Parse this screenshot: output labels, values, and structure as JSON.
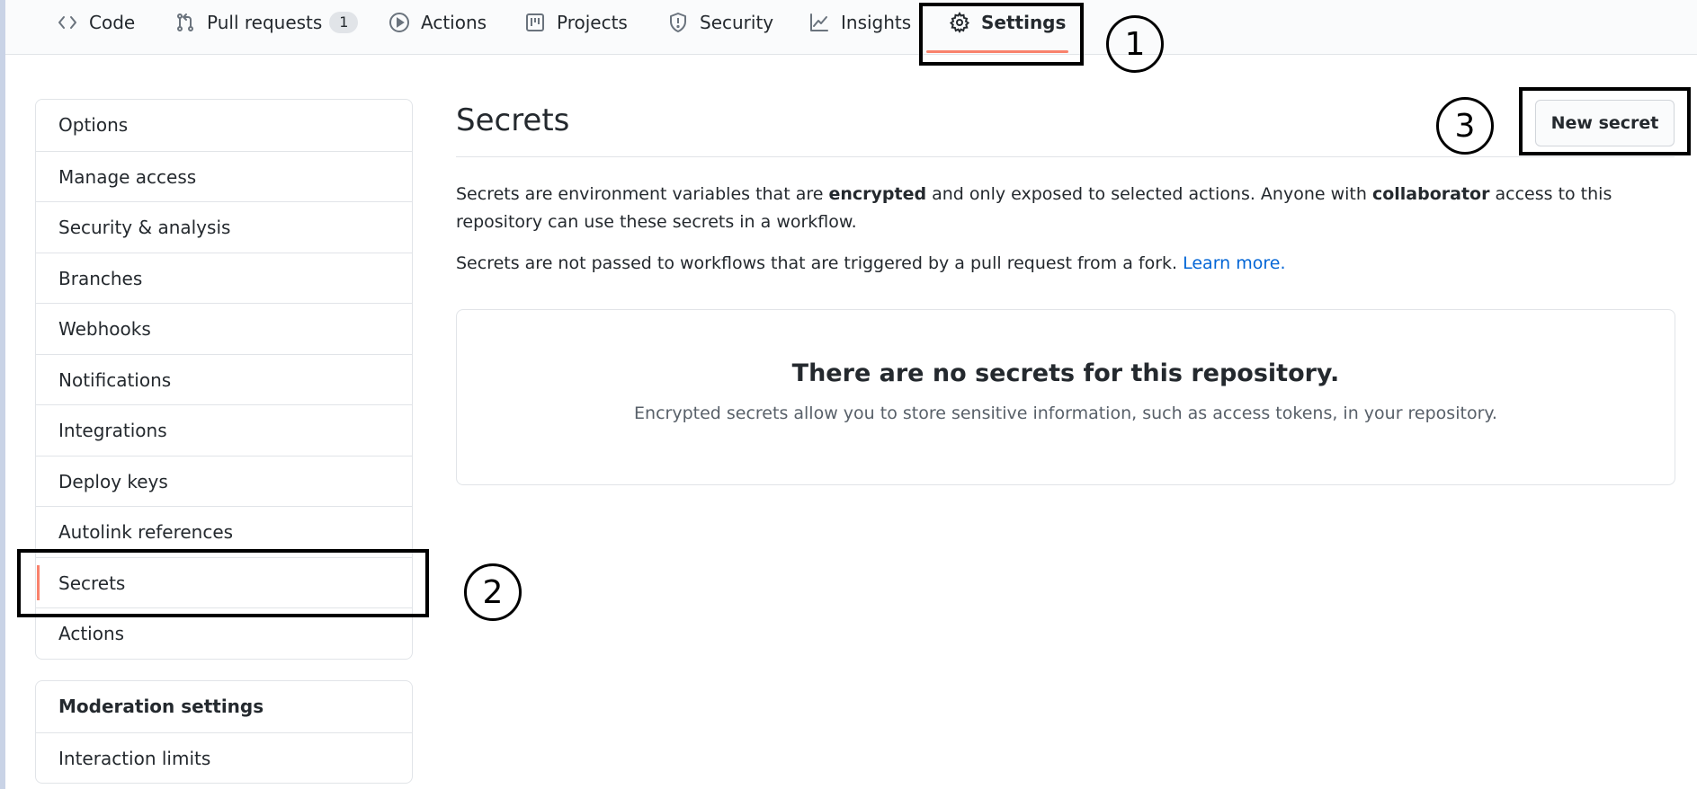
{
  "tabs": [
    {
      "label": "Code",
      "icon": "code-icon"
    },
    {
      "label": "Pull requests",
      "icon": "pull-request-icon",
      "counter": "1"
    },
    {
      "label": "Actions",
      "icon": "play-icon"
    },
    {
      "label": "Projects",
      "icon": "project-icon"
    },
    {
      "label": "Security",
      "icon": "shield-icon"
    },
    {
      "label": "Insights",
      "icon": "graph-icon"
    },
    {
      "label": "Settings",
      "icon": "gear-icon",
      "selected": true
    }
  ],
  "sidebar": {
    "items": [
      {
        "label": "Options"
      },
      {
        "label": "Manage access"
      },
      {
        "label": "Security & analysis"
      },
      {
        "label": "Branches"
      },
      {
        "label": "Webhooks"
      },
      {
        "label": "Notifications"
      },
      {
        "label": "Integrations"
      },
      {
        "label": "Deploy keys"
      },
      {
        "label": "Autolink references"
      },
      {
        "label": "Secrets",
        "active": true
      },
      {
        "label": "Actions"
      }
    ],
    "moderation": {
      "heading": "Moderation settings",
      "items": [
        {
          "label": "Interaction limits"
        }
      ]
    }
  },
  "main": {
    "title": "Secrets",
    "new_secret_label": "New secret",
    "para1": {
      "t1": "Secrets are environment variables that are ",
      "b1": "encrypted",
      "t2": " and only exposed to selected actions. Anyone with ",
      "b2": "collaborator",
      "t3": " access to this repository can use these secrets in a workflow."
    },
    "para2": {
      "text": "Secrets are not passed to workflows that are triggered by a pull request from a fork. ",
      "link": "Learn more."
    },
    "empty_state": {
      "title": "There are no secrets for this repository.",
      "description": "Encrypted secrets allow you to store sensitive information, such as access tokens, in your repository."
    }
  },
  "annotations": [
    "1",
    "2",
    "3"
  ],
  "colors": {
    "accent_underline": "#f9826c",
    "link": "#0366d6",
    "border": "#e1e4e8",
    "annotation": "#000000"
  }
}
